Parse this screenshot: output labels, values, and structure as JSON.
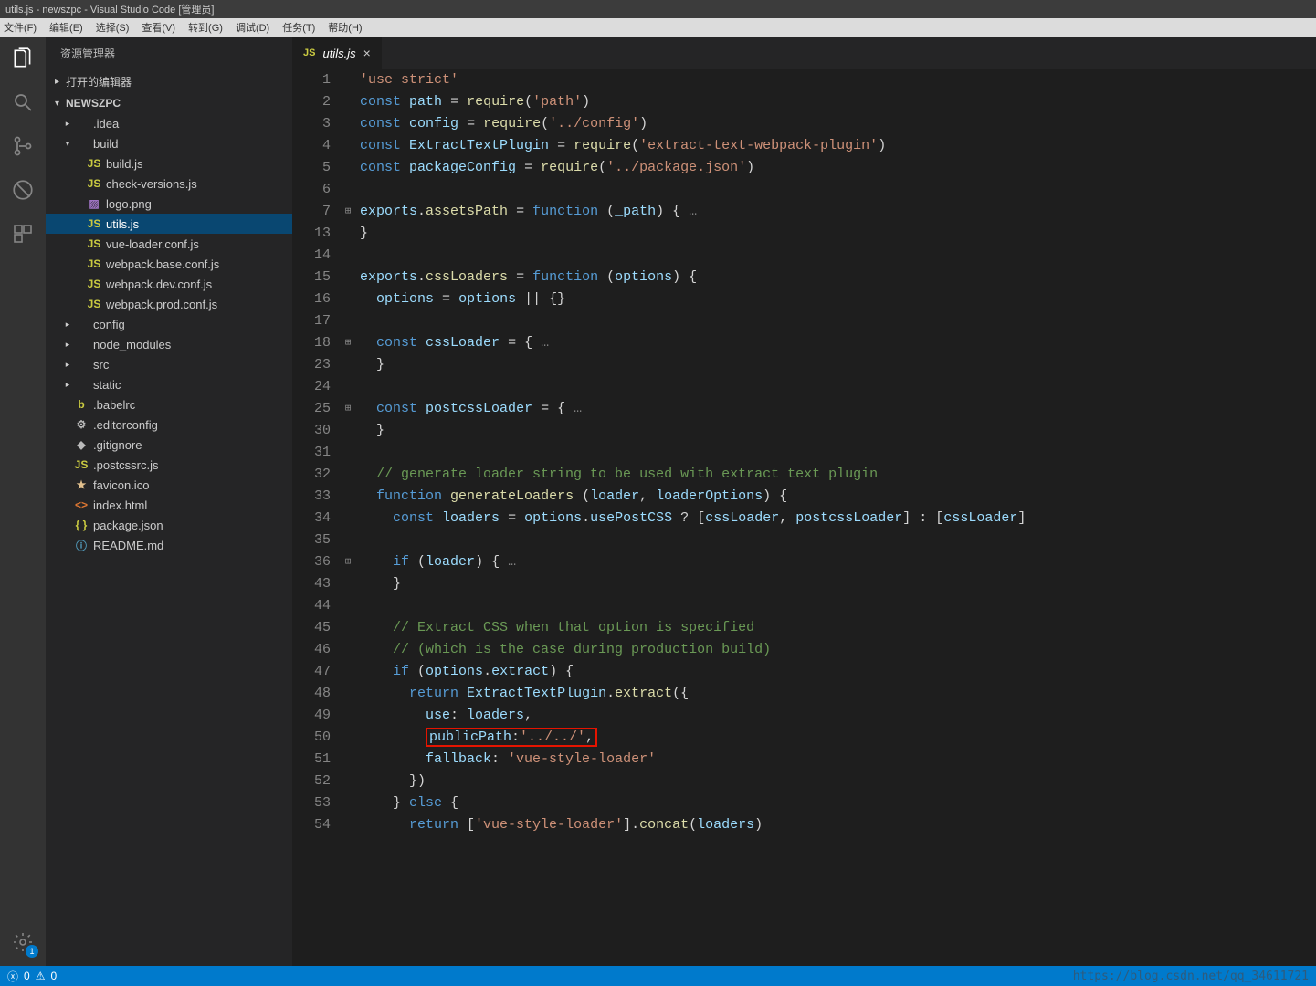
{
  "title_bar": "utils.js - newszpc - Visual Studio Code [管理员]",
  "menu": [
    "文件(F)",
    "编辑(E)",
    "选择(S)",
    "查看(V)",
    "转到(G)",
    "调试(D)",
    "任务(T)",
    "帮助(H)"
  ],
  "sidebar": {
    "title": "资源管理器",
    "sections": {
      "open_editors": "打开的编辑器",
      "project": "NEWSZPC"
    },
    "tree": [
      {
        "depth": 0,
        "type": "folder",
        "chev": "▸",
        "label": ".idea"
      },
      {
        "depth": 0,
        "type": "folder",
        "chev": "▾",
        "label": "build"
      },
      {
        "depth": 1,
        "type": "js",
        "label": "build.js"
      },
      {
        "depth": 1,
        "type": "js",
        "label": "check-versions.js"
      },
      {
        "depth": 1,
        "type": "img",
        "label": "logo.png"
      },
      {
        "depth": 1,
        "type": "js",
        "label": "utils.js",
        "selected": true
      },
      {
        "depth": 1,
        "type": "js",
        "label": "vue-loader.conf.js"
      },
      {
        "depth": 1,
        "type": "js",
        "label": "webpack.base.conf.js"
      },
      {
        "depth": 1,
        "type": "js",
        "label": "webpack.dev.conf.js"
      },
      {
        "depth": 1,
        "type": "js",
        "label": "webpack.prod.conf.js"
      },
      {
        "depth": 0,
        "type": "folder",
        "chev": "▸",
        "label": "config"
      },
      {
        "depth": 0,
        "type": "folder",
        "chev": "▸",
        "label": "node_modules"
      },
      {
        "depth": 0,
        "type": "folder",
        "chev": "▸",
        "label": "src"
      },
      {
        "depth": 0,
        "type": "folder",
        "chev": "▸",
        "label": "static"
      },
      {
        "depth": 0,
        "type": "babel",
        "label": ".babelrc"
      },
      {
        "depth": 0,
        "type": "gear",
        "label": ".editorconfig"
      },
      {
        "depth": 0,
        "type": "diamond",
        "label": ".gitignore"
      },
      {
        "depth": 0,
        "type": "js",
        "label": ".postcssrc.js"
      },
      {
        "depth": 0,
        "type": "star",
        "label": "favicon.ico"
      },
      {
        "depth": 0,
        "type": "html",
        "label": "index.html"
      },
      {
        "depth": 0,
        "type": "json",
        "label": "package.json"
      },
      {
        "depth": 0,
        "type": "info",
        "label": "README.md"
      }
    ]
  },
  "tab": {
    "icon": "JS",
    "label": "utils.js"
  },
  "gutter_badge": "1",
  "status": {
    "errors": "0",
    "warnings": "0"
  },
  "watermark": "https://blog.csdn.net/qq_34611721",
  "code_lines": [
    {
      "n": 1,
      "fold": "",
      "html": "<span class='tok-str'>'use strict'</span>"
    },
    {
      "n": 2,
      "fold": "",
      "html": "<span class='tok-kw'>const</span> <span class='tok-var'>path</span> <span class='tok-op'>=</span> <span class='tok-fn'>require</span>(<span class='tok-str'>'path'</span>)"
    },
    {
      "n": 3,
      "fold": "",
      "html": "<span class='tok-kw'>const</span> <span class='tok-var'>config</span> <span class='tok-op'>=</span> <span class='tok-fn'>require</span>(<span class='tok-str'>'../config'</span>)"
    },
    {
      "n": 4,
      "fold": "",
      "html": "<span class='tok-kw'>const</span> <span class='tok-var'>ExtractTextPlugin</span> <span class='tok-op'>=</span> <span class='tok-fn'>require</span>(<span class='tok-str'>'extract-text-webpack-plugin'</span>)"
    },
    {
      "n": 5,
      "fold": "",
      "html": "<span class='tok-kw'>const</span> <span class='tok-var'>packageConfig</span> <span class='tok-op'>=</span> <span class='tok-fn'>require</span>(<span class='tok-str'>'../package.json'</span>)"
    },
    {
      "n": 6,
      "fold": "",
      "html": ""
    },
    {
      "n": 7,
      "fold": "⊞",
      "html": "<span class='tok-var'>exports</span>.<span class='tok-fn'>assetsPath</span> <span class='tok-op'>=</span> <span class='tok-kw'>function</span> (<span class='tok-var'>_path</span>) {<span class='tok-dim'> …</span>"
    },
    {
      "n": 13,
      "fold": "",
      "html": "}"
    },
    {
      "n": 14,
      "fold": "",
      "html": ""
    },
    {
      "n": 15,
      "fold": "",
      "html": "<span class='tok-var'>exports</span>.<span class='tok-fn'>cssLoaders</span> <span class='tok-op'>=</span> <span class='tok-kw'>function</span> (<span class='tok-var'>options</span>) {"
    },
    {
      "n": 16,
      "fold": "",
      "html": "  <span class='tok-var'>options</span> <span class='tok-op'>=</span> <span class='tok-var'>options</span> <span class='tok-op'>||</span> {}"
    },
    {
      "n": 17,
      "fold": "",
      "html": ""
    },
    {
      "n": 18,
      "fold": "⊞",
      "html": "  <span class='tok-kw'>const</span> <span class='tok-var'>cssLoader</span> <span class='tok-op'>=</span> {<span class='tok-dim'> …</span>"
    },
    {
      "n": 23,
      "fold": "",
      "html": "  }"
    },
    {
      "n": 24,
      "fold": "",
      "html": ""
    },
    {
      "n": 25,
      "fold": "⊞",
      "html": "  <span class='tok-kw'>const</span> <span class='tok-var'>postcssLoader</span> <span class='tok-op'>=</span> {<span class='tok-dim'> …</span>"
    },
    {
      "n": 30,
      "fold": "",
      "html": "  }"
    },
    {
      "n": 31,
      "fold": "",
      "html": ""
    },
    {
      "n": 32,
      "fold": "",
      "html": "  <span class='tok-com'>// generate loader string to be used with extract text plugin</span>"
    },
    {
      "n": 33,
      "fold": "",
      "html": "  <span class='tok-kw'>function</span> <span class='tok-fn'>generateLoaders</span> (<span class='tok-var'>loader</span>, <span class='tok-var'>loaderOptions</span>) {"
    },
    {
      "n": 34,
      "fold": "",
      "html": "    <span class='tok-kw'>const</span> <span class='tok-var'>loaders</span> <span class='tok-op'>=</span> <span class='tok-var'>options</span>.<span class='tok-var'>usePostCSS</span> <span class='tok-op'>?</span> [<span class='tok-var'>cssLoader</span>, <span class='tok-var'>postcssLoader</span>] <span class='tok-op'>:</span> [<span class='tok-var'>cssLoader</span>]"
    },
    {
      "n": 35,
      "fold": "",
      "html": ""
    },
    {
      "n": 36,
      "fold": "⊞",
      "html": "    <span class='tok-kw'>if</span> (<span class='tok-var'>loader</span>) {<span class='tok-dim'> …</span>"
    },
    {
      "n": 43,
      "fold": "",
      "html": "    }"
    },
    {
      "n": 44,
      "fold": "",
      "html": ""
    },
    {
      "n": 45,
      "fold": "",
      "html": "    <span class='tok-com'>// Extract CSS when that option is specified</span>"
    },
    {
      "n": 46,
      "fold": "",
      "html": "    <span class='tok-com'>// (which is the case during production build)</span>"
    },
    {
      "n": 47,
      "fold": "",
      "html": "    <span class='tok-kw'>if</span> (<span class='tok-var'>options</span>.<span class='tok-var'>extract</span>) {"
    },
    {
      "n": 48,
      "fold": "",
      "html": "      <span class='tok-kw'>return</span> <span class='tok-var'>ExtractTextPlugin</span>.<span class='tok-fn'>extract</span>({"
    },
    {
      "n": 49,
      "fold": "",
      "html": "        <span class='tok-var'>use</span>: <span class='tok-var'>loaders</span>,"
    },
    {
      "n": 50,
      "fold": "",
      "html": "        <span class='red-box'><span class='tok-var'>publicPath</span>:<span class='tok-str'>'../../'</span>,</span>"
    },
    {
      "n": 51,
      "fold": "",
      "html": "        <span class='tok-var'>fallback</span>: <span class='tok-str'>'vue-style-loader'</span>"
    },
    {
      "n": 52,
      "fold": "",
      "html": "      })"
    },
    {
      "n": 53,
      "fold": "",
      "html": "    } <span class='tok-kw'>else</span> {"
    },
    {
      "n": 54,
      "fold": "",
      "html": "      <span class='tok-kw'>return</span> [<span class='tok-str'>'vue-style-loader'</span>].<span class='tok-fn'>concat</span>(<span class='tok-var'>loaders</span>)"
    }
  ]
}
